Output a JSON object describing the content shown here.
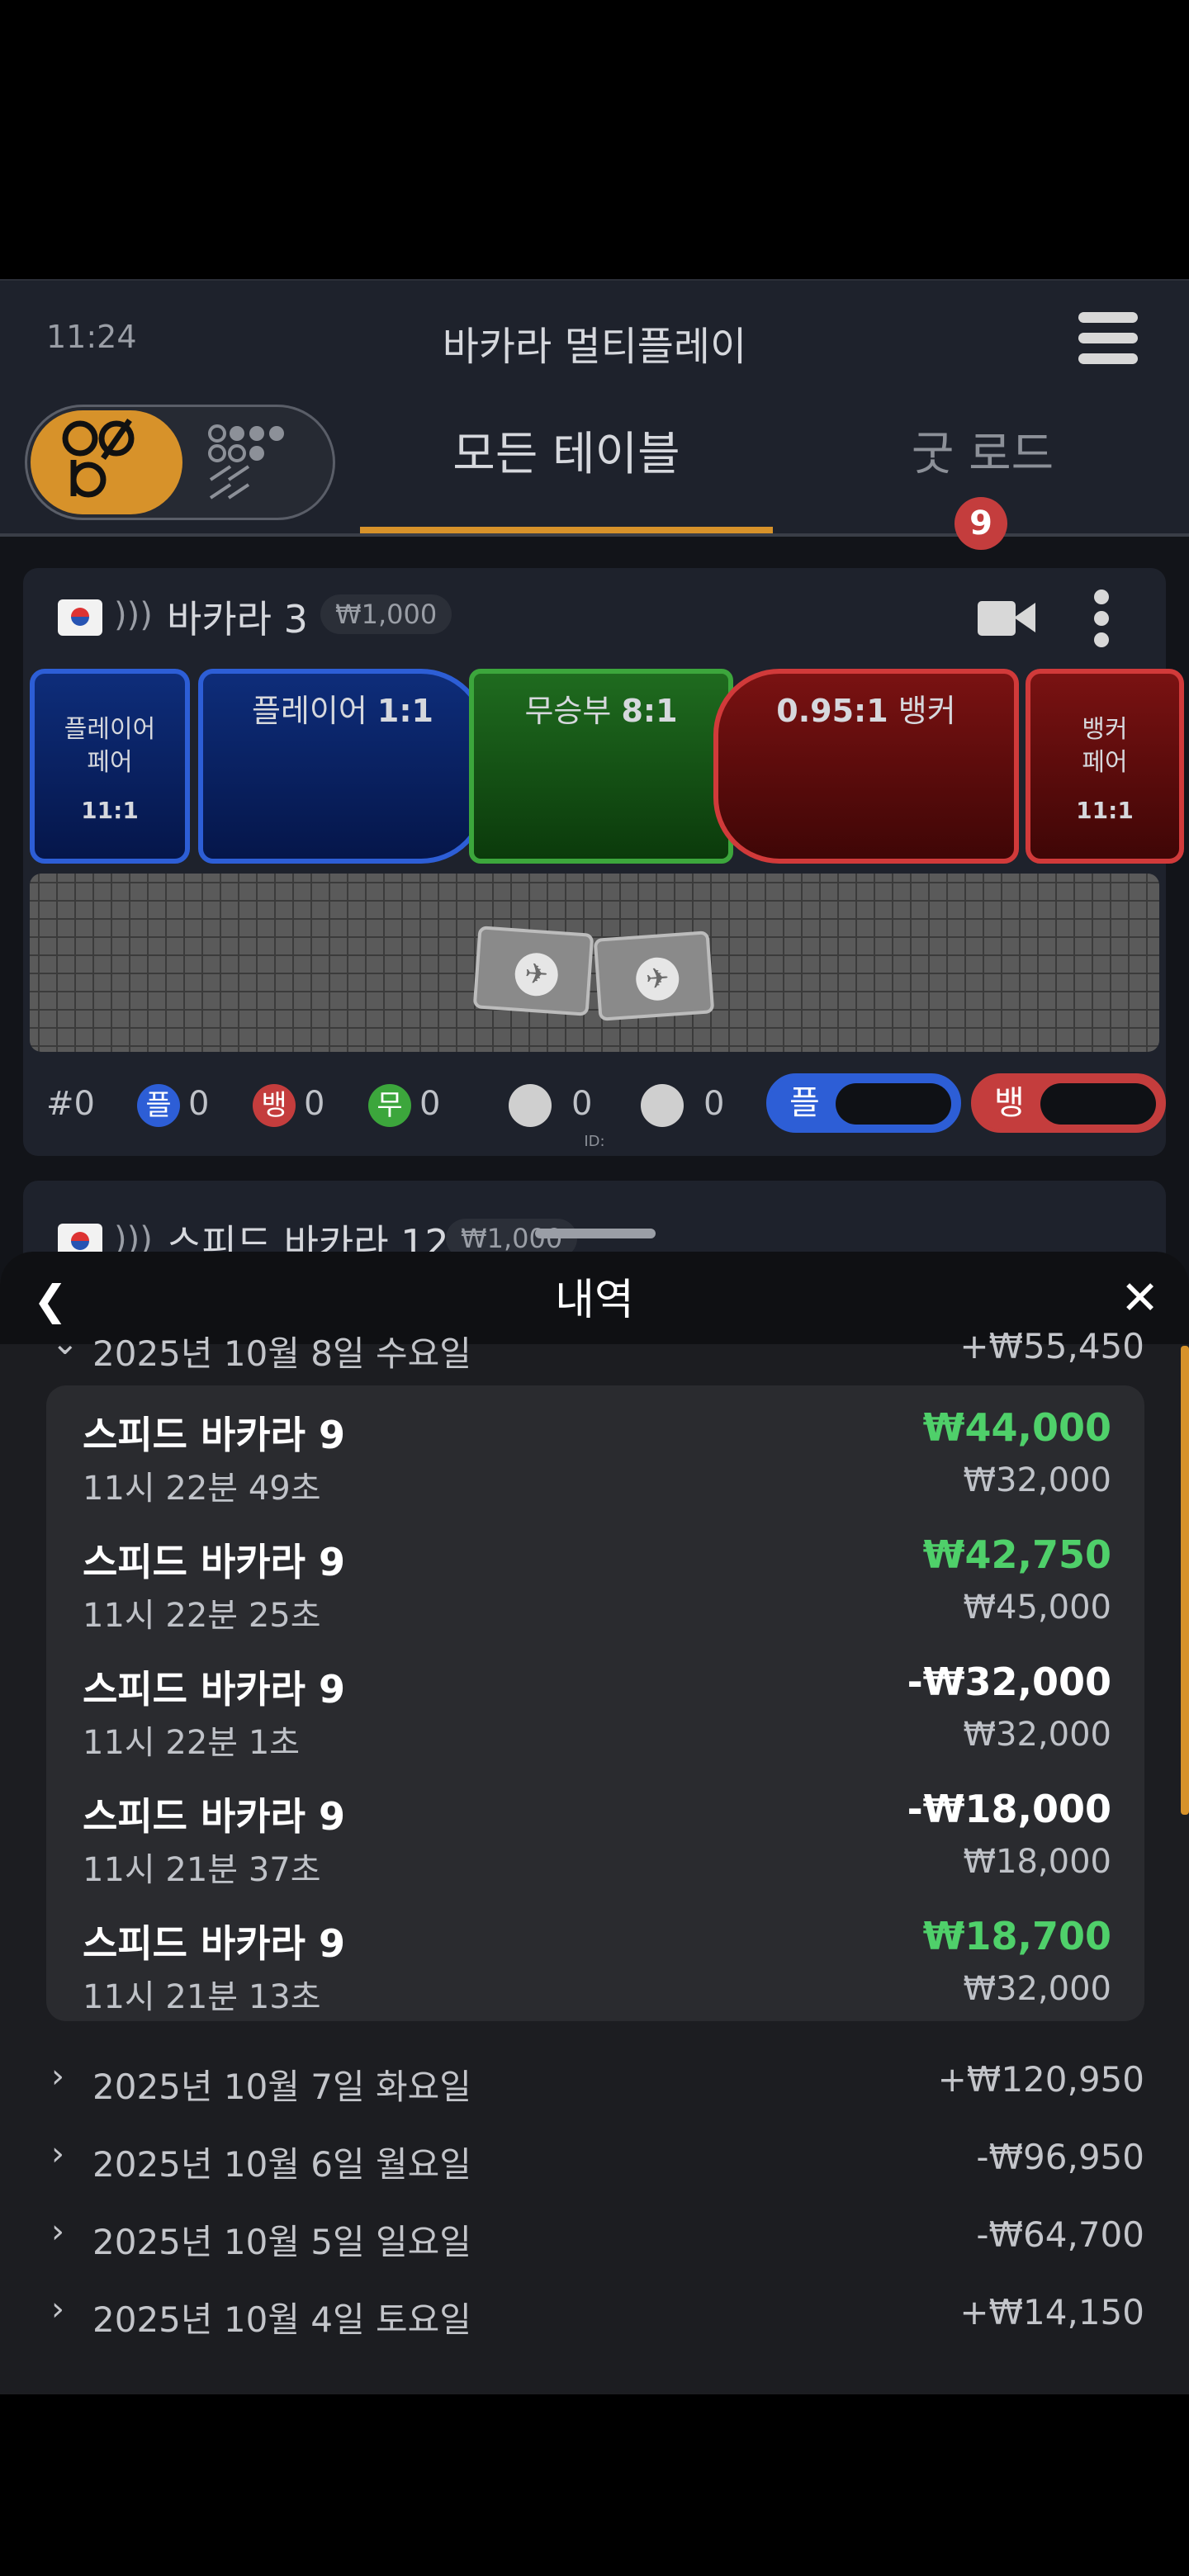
{
  "header": {
    "time": "11:24",
    "title": "바카라 멀티플레이",
    "tabs": {
      "all": "모든 테이블",
      "road": "굿 로드",
      "road_badge": "9"
    }
  },
  "table_card": {
    "name": "바카라 3",
    "limit": "₩1,000",
    "bets": {
      "player_pair": {
        "line1": "플레이어",
        "line2": "페어",
        "odds": "11:1"
      },
      "player": {
        "label": "플레이어",
        "odds": "1:1"
      },
      "tie": {
        "label": "무승부",
        "odds": "8:1"
      },
      "banker": {
        "odds": "0.95:1",
        "label": "뱅커"
      },
      "banker_pair": {
        "line1": "뱅커",
        "line2": "페어",
        "odds": "11:1"
      }
    },
    "stats": {
      "rounds": "#0",
      "player_chip": "플",
      "player_count": "0",
      "banker_chip": "뱅",
      "banker_count": "0",
      "tie_chip": "무",
      "tie_count": "0",
      "player_pair_count": "0",
      "banker_pair_count": "0",
      "player_button": "플",
      "banker_button": "뱅"
    },
    "id_label": "ID:"
  },
  "next_card": {
    "name": "스피드 바카라 12",
    "limit": "₩1,000"
  },
  "history": {
    "title": "내역",
    "expanded_day": {
      "date": "2025년 10월 8일 수요일",
      "total": "+₩55,450",
      "transactions": [
        {
          "game": "스피드 바카라 9",
          "time": "11시 22분 49초",
          "amount": "₩44,000",
          "stake": "₩32,000"
        },
        {
          "game": "스피드 바카라 9",
          "time": "11시 22분 25초",
          "amount": "₩42,750",
          "stake": "₩45,000"
        },
        {
          "game": "스피드 바카라 9",
          "time": "11시 22분 1초",
          "amount": "-₩32,000",
          "stake": "₩32,000"
        },
        {
          "game": "스피드 바카라 9",
          "time": "11시 21분 37초",
          "amount": "-₩18,000",
          "stake": "₩18,000"
        },
        {
          "game": "스피드 바카라 9",
          "time": "11시 21분 13초",
          "amount": "₩18,700",
          "stake": "₩32,000"
        }
      ]
    },
    "collapsed_days": [
      {
        "date": "2025년 10월 7일 화요일",
        "total": "+₩120,950"
      },
      {
        "date": "2025년 10월 6일 월요일",
        "total": "-₩96,950"
      },
      {
        "date": "2025년 10월 5일 일요일",
        "total": "-₩64,700"
      },
      {
        "date": "2025년 10월 4일 토요일",
        "total": "+₩14,150"
      }
    ]
  },
  "colors": {
    "accent": "#d7922a",
    "player": "#2d5ed6",
    "banker": "#c43d3d",
    "tie": "#3ca63c",
    "win": "#4fd06a"
  }
}
